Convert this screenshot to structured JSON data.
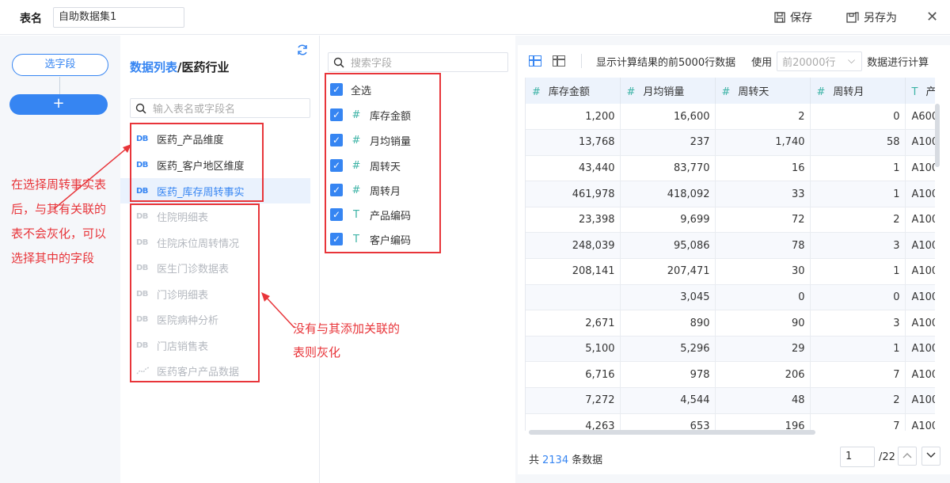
{
  "header": {
    "table_name_label": "表名",
    "table_name_value": "自助数据集1",
    "save_label": "保存",
    "save_as_label": "另存为",
    "close_symbol": "✕"
  },
  "steps": {
    "select_fields_label": "选字段",
    "add_symbol": "+"
  },
  "data_list": {
    "title_prefix": "数据列表",
    "title_suffix": "/医药行业",
    "search_placeholder": "输入表名或字段名",
    "db_icon_text": "DB",
    "items": [
      {
        "label": "医药_产品维度",
        "state": "enabled"
      },
      {
        "label": "医药_客户地区维度",
        "state": "enabled"
      },
      {
        "label": "医药_库存周转事实",
        "state": "selected"
      },
      {
        "label": "住院明细表",
        "state": "disabled"
      },
      {
        "label": "住院床位周转情况",
        "state": "disabled"
      },
      {
        "label": "医生门诊数据表",
        "state": "disabled"
      },
      {
        "label": "门诊明细表",
        "state": "disabled"
      },
      {
        "label": "医院病种分析",
        "state": "disabled"
      },
      {
        "label": "门店销售表",
        "state": "disabled"
      },
      {
        "label": "医药客户产品数据",
        "state": "disabled"
      }
    ]
  },
  "field_list": {
    "search_placeholder": "搜索字段",
    "select_all_label": "全选",
    "fields": [
      {
        "type": "#",
        "label": "库存金额"
      },
      {
        "type": "#",
        "label": "月均销量"
      },
      {
        "type": "#",
        "label": "周转天"
      },
      {
        "type": "#",
        "label": "周转月"
      },
      {
        "type": "T",
        "label": "产品编码"
      },
      {
        "type": "T",
        "label": "客户编码"
      }
    ]
  },
  "preview": {
    "info_text": "显示计算结果的前5000行数据",
    "use_label": "使用",
    "rows_select_placeholder": "前20000行",
    "compute_label": "数据进行计算",
    "columns": [
      {
        "type": "#",
        "label": "库存金额"
      },
      {
        "type": "#",
        "label": "月均销量"
      },
      {
        "type": "#",
        "label": "周转天"
      },
      {
        "type": "#",
        "label": "周转月"
      },
      {
        "type": "T",
        "label": "产"
      }
    ],
    "rows": [
      [
        "1,200",
        "16,600",
        "2",
        "0",
        "A600"
      ],
      [
        "13,768",
        "237",
        "1,740",
        "58",
        "A100"
      ],
      [
        "43,440",
        "83,770",
        "16",
        "1",
        "A100"
      ],
      [
        "461,978",
        "418,092",
        "33",
        "1",
        "A100"
      ],
      [
        "23,398",
        "9,699",
        "72",
        "2",
        "A100"
      ],
      [
        "248,039",
        "95,086",
        "78",
        "3",
        "A100"
      ],
      [
        "208,141",
        "207,471",
        "30",
        "1",
        "A100"
      ],
      [
        "",
        "3,045",
        "0",
        "0",
        "A100"
      ],
      [
        "2,671",
        "890",
        "90",
        "3",
        "A100"
      ],
      [
        "5,100",
        "5,296",
        "29",
        "1",
        "A100"
      ],
      [
        "6,716",
        "978",
        "206",
        "7",
        "A100"
      ],
      [
        "7,272",
        "4,544",
        "48",
        "2",
        "A100"
      ],
      [
        "4,263",
        "653",
        "196",
        "7",
        "A100"
      ]
    ],
    "total_prefix": "共",
    "total_count": "2134",
    "total_suffix": "条数据",
    "page_value": "1",
    "page_total": "/22"
  },
  "annotations": {
    "left_note": "在选择周转事实表后，与其有关联的表不会灰化，可以选择其中的字段",
    "right_note": "没有与其添加关联的表则灰化",
    "color": "#e8353a"
  },
  "colors": {
    "accent": "#3685f2",
    "field_type": "#3db3a6",
    "disabled_text": "#b4b8bf"
  },
  "icons": [
    "save-icon",
    "save-as-icon",
    "close-icon",
    "refresh-icon",
    "search-icon",
    "database-icon",
    "line-chart-icon",
    "checkbox-icon",
    "grid-view-icon",
    "table-view-icon",
    "chevron-down-icon",
    "chevron-up-icon"
  ]
}
